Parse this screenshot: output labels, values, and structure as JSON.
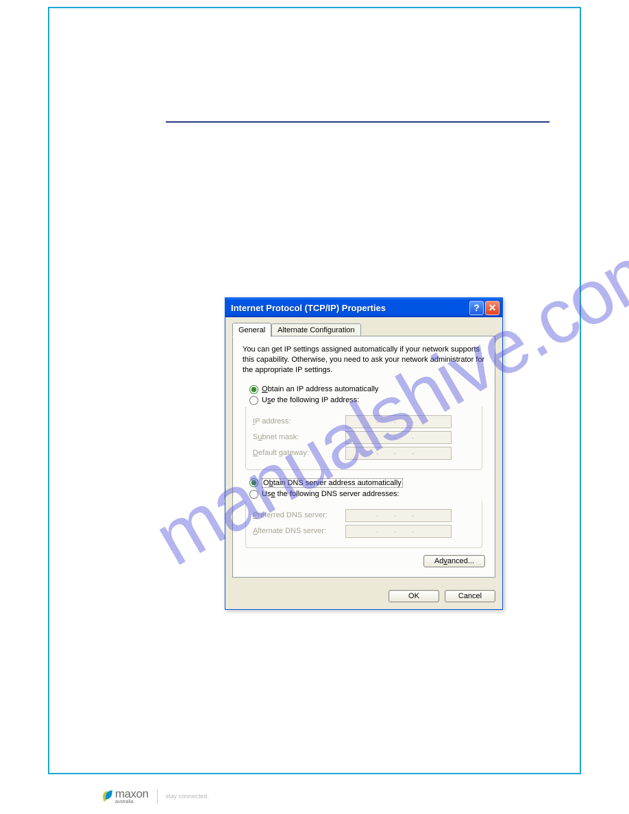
{
  "dialog": {
    "title": "Internet Protocol (TCP/IP) Properties",
    "tabs": {
      "general": "General",
      "alternate": "Alternate Configuration"
    },
    "description": "You can get IP settings assigned automatically if your network supports this capability. Otherwise, you need to ask your network administrator for the appropriate IP settings.",
    "radios": {
      "obtain_ip": "Obtain an IP address automatically",
      "use_ip": "Use the following IP address:",
      "obtain_dns": "Obtain DNS server address automatically",
      "use_dns": "Use the following DNS server addresses:"
    },
    "fields": {
      "ip_address": "IP address:",
      "subnet_mask": "Subnet mask:",
      "default_gateway": "Default gateway:",
      "preferred_dns": "Preferred DNS server:",
      "alternate_dns": "Alternate DNS server:"
    },
    "ip_placeholder": ".   .   .",
    "buttons": {
      "advanced": "Advanced...",
      "ok": "OK",
      "cancel": "Cancel"
    }
  },
  "watermark": "manualshive.com",
  "footer": {
    "brand": "maxon",
    "sub": "australia.",
    "tagline": "stay connected."
  }
}
